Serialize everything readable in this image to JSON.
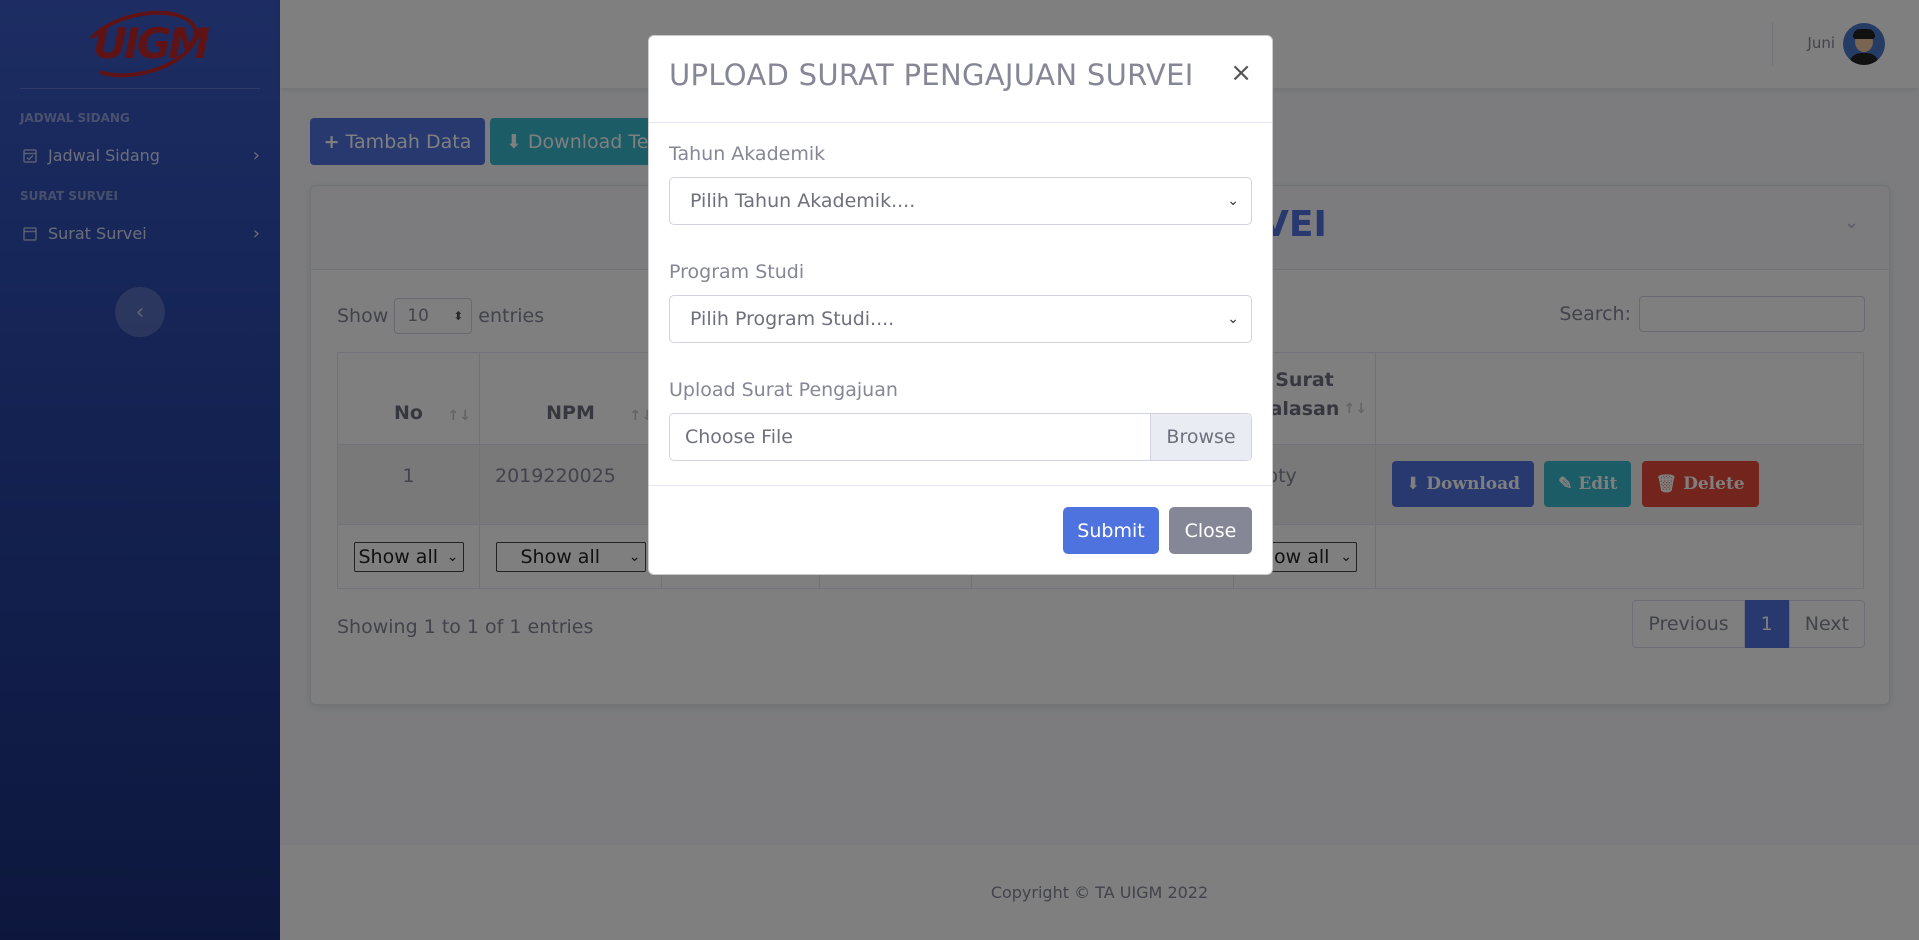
{
  "brand": {
    "logo_text": "UIGM"
  },
  "sidebar": {
    "sections": [
      {
        "heading": "JADWAL SIDANG",
        "item": "Jadwal Sidang",
        "icon": "calendar-check-icon"
      },
      {
        "heading": "SURAT SURVEI",
        "item": "Surat Survei",
        "icon": "calendar-icon"
      }
    ],
    "toggle_icon": "chevron-left-icon"
  },
  "topbar": {
    "user_name": "Juni"
  },
  "toolbar": {
    "add_label": "Tambah Data",
    "download_template_label": "Download Te"
  },
  "card": {
    "title_fragment": "VEI"
  },
  "datatable": {
    "show_label": "Show",
    "length_value": "10",
    "entries_label": "entries",
    "search_label": "Search:",
    "columns": [
      "No",
      "NPM",
      "",
      "",
      "",
      "Surat\nalasan",
      ""
    ],
    "row": {
      "no": "1",
      "npm": "2019220025",
      "surat": "npty"
    },
    "filter_label": "Show all",
    "filter_partial": "how all",
    "actions": {
      "download": "Download",
      "edit": "Edit",
      "delete": "Delete"
    },
    "info": "Showing 1 to 1 of 1 entries",
    "pagination": {
      "previous": "Previous",
      "page": "1",
      "next": "Next"
    }
  },
  "footer": {
    "copyright": "Copyright © TA UIGM 2022"
  },
  "modal": {
    "title": "UPLOAD SURAT PENGAJUAN SURVEI",
    "close_glyph": "×",
    "tahun_label": "Tahun Akademik",
    "tahun_placeholder": "Pilih Tahun Akademik....",
    "prodi_label": "Program Studi",
    "prodi_placeholder": "Pilih Program Studi....",
    "upload_label": "Upload Surat Pengajuan",
    "file_placeholder": "Choose File",
    "browse_label": "Browse",
    "submit_label": "Submit",
    "close_label": "Close"
  },
  "colors": {
    "primary": "#4e73df",
    "info": "#36b9cc",
    "danger": "#e74a3b",
    "secondary": "#858796"
  }
}
